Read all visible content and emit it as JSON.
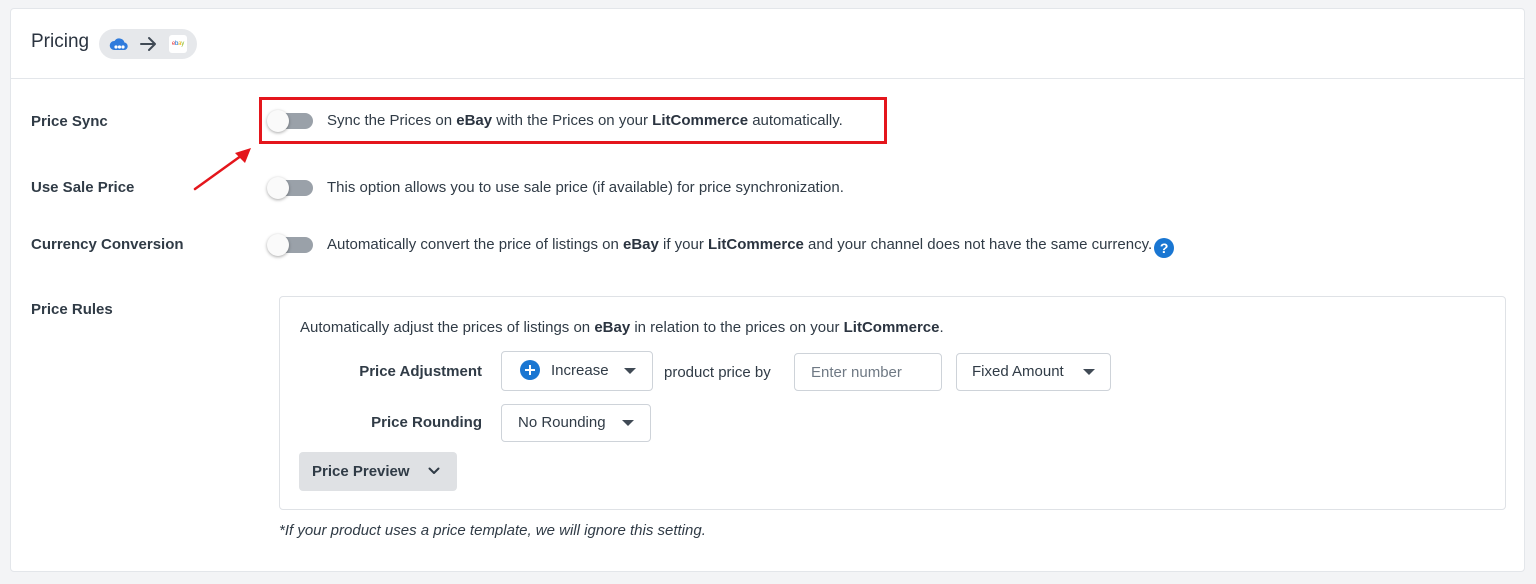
{
  "header": {
    "title": "Pricing",
    "source_icon": "litcommerce-cloud-icon",
    "arrow_icon": "arrow-right-icon",
    "target_logo_text": "ebay"
  },
  "rows": {
    "price_sync": {
      "label": "Price Sync",
      "enabled": false,
      "text_1": "Sync the Prices on ",
      "bold_1": "eBay",
      "text_2": " with the Prices on your ",
      "bold_2": "LitCommerce",
      "text_3": " automatically."
    },
    "use_sale_price": {
      "label": "Use Sale Price",
      "enabled": false,
      "text": "This option allows you to use sale price (if available) for price synchronization."
    },
    "currency_conversion": {
      "label": "Currency Conversion",
      "enabled": false,
      "text_1": "Automatically convert the price of listings on ",
      "bold_1": "eBay",
      "text_2": " if your ",
      "bold_2": "LitCommerce",
      "text_3": " and your channel does not have the same currency.",
      "help_glyph": "?"
    },
    "price_rules": {
      "label": "Price Rules"
    }
  },
  "rules": {
    "desc_1": "Automatically adjust the prices of listings on ",
    "desc_bold_1": "eBay",
    "desc_2": " in relation to the prices on your ",
    "desc_bold_2": "LitCommerce",
    "desc_3": ".",
    "price_adjustment_label": "Price Adjustment",
    "adjustment_direction": "Increase",
    "product_price_by": "product price by",
    "amount_placeholder": "Enter number",
    "amount_type": "Fixed Amount",
    "price_rounding_label": "Price Rounding",
    "rounding_value": "No Rounding",
    "preview_button": "Price Preview"
  },
  "footnote": "*If your product uses a price template, we will ignore this setting.",
  "colors": {
    "accent_blue": "#1976d2",
    "highlight_red": "#e4161c",
    "toggle_off": "#9aa1a9"
  }
}
